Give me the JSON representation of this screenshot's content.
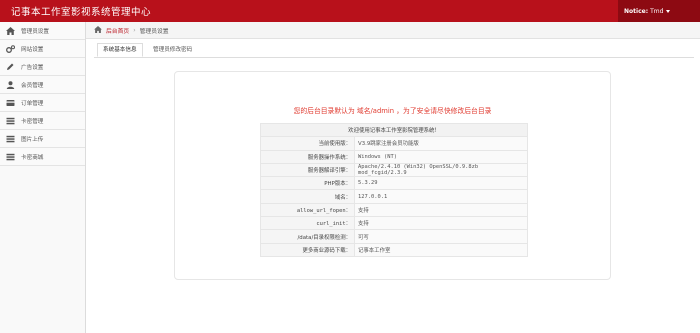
{
  "header": {
    "title": "记事本工作室影视系统管理中心",
    "notice_label": "Notice:",
    "notice_value": "Tmd"
  },
  "sidebar": {
    "items": [
      {
        "label": "管理员设置",
        "icon": "home-icon"
      },
      {
        "label": "网站设置",
        "icon": "gears-icon"
      },
      {
        "label": "广告设置",
        "icon": "pencil-icon"
      },
      {
        "label": "会员管理",
        "icon": "user-icon"
      },
      {
        "label": "订单管理",
        "icon": "credit-card-icon"
      },
      {
        "label": "卡密管理",
        "icon": "list-icon"
      },
      {
        "label": "图片上传",
        "icon": "list-icon"
      },
      {
        "label": "卡密商城",
        "icon": "list-icon"
      }
    ]
  },
  "breadcrumb": {
    "home": "后台首页",
    "current": "管理员设置"
  },
  "tabs": [
    {
      "label": "系统基本信息",
      "active": true
    },
    {
      "label": "管理员修改密码",
      "active": false
    }
  ],
  "warning": "您的后台目录默认为 域名/admin ，为了安全请尽快修改后台目录",
  "info_table": {
    "header": "欢迎使用记事本工作室影院管理系统！",
    "rows": [
      {
        "key": "当前使用版：",
        "value": "V3.9跳家注册会员功能版"
      },
      {
        "key": "服务器操作系统：",
        "value": "Windows (NT)"
      },
      {
        "key": "服务器解译引擎：",
        "value": "Apache/2.4.10 (Win32) OpenSSL/0.9.8zb mod_fcgid/2.3.9"
      },
      {
        "key": "PHP版本：",
        "value": "5.3.29"
      },
      {
        "key": "域名：",
        "value": "127.0.0.1"
      },
      {
        "key": "allow_url_fopen：",
        "value": "支持"
      },
      {
        "key": "curl_init：",
        "value": "支持"
      },
      {
        "key": "/data/目录权限检测：",
        "value": "可写"
      },
      {
        "key": "更多商业源码下载：",
        "value": "记事本工作室"
      }
    ]
  },
  "colors": {
    "header_bg": "#b8111b",
    "warning": "#e03a2f",
    "ok_green": "#2e9f3e",
    "link_blue": "#2a6ebb"
  }
}
